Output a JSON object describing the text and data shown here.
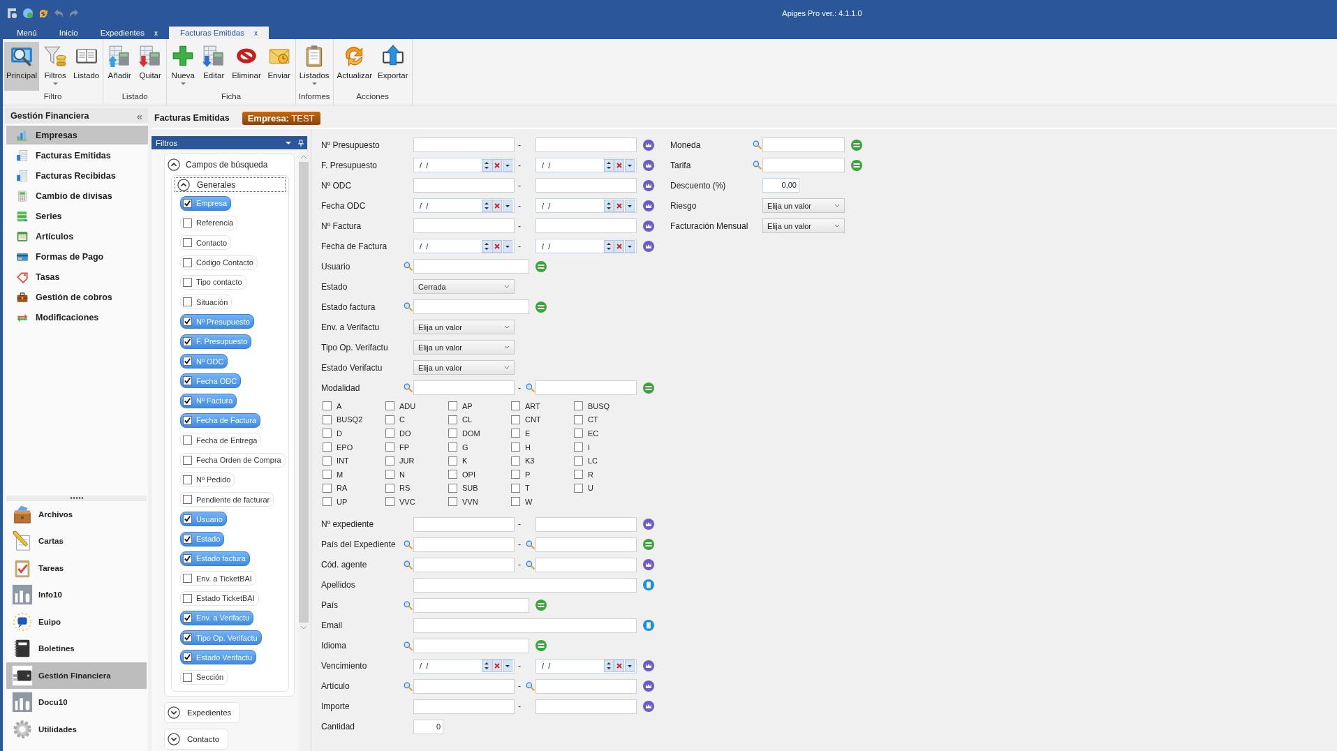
{
  "window": {
    "title": "Apiges Pro ver.: 4.1.1.0"
  },
  "tabs": [
    {
      "label": "Menú",
      "selected": false
    },
    {
      "label": "Inicio",
      "selected": false
    },
    {
      "label": "Expedientes",
      "selected": false,
      "close": "x"
    },
    {
      "label": "Facturas Emitidas",
      "selected": true,
      "close": "x"
    }
  ],
  "ribbon": {
    "groups": [
      {
        "label": "Filtro",
        "buttons": [
          {
            "label": "Principal",
            "kind": "magnifier",
            "selected": true,
            "dropdown": false
          },
          {
            "label": "Filtros",
            "kind": "funnel",
            "selected": false,
            "dropdown": true
          },
          {
            "label": "Listado",
            "kind": "book",
            "selected": false,
            "dropdown": false
          }
        ]
      },
      {
        "label": "Listado",
        "buttons": [
          {
            "label": "Añadir",
            "kind": "sheet_add",
            "selected": false,
            "dropdown": false
          },
          {
            "label": "Quitar",
            "kind": "sheet_remove",
            "selected": false,
            "dropdown": false
          }
        ]
      },
      {
        "label": "Ficha",
        "buttons": [
          {
            "label": "Nueva",
            "kind": "plus",
            "selected": false,
            "dropdown": true
          },
          {
            "label": "Editar",
            "kind": "sheet_edit",
            "selected": false,
            "dropdown": false
          },
          {
            "label": "Eliminar",
            "kind": "forbidden",
            "selected": false,
            "dropdown": false
          },
          {
            "label": "Enviar",
            "kind": "mail",
            "selected": false,
            "dropdown": false
          }
        ]
      },
      {
        "label": "Informes",
        "buttons": [
          {
            "label": "Listados",
            "kind": "clipboard",
            "selected": false,
            "dropdown": true
          }
        ]
      },
      {
        "label": "Acciones",
        "buttons": [
          {
            "label": "Actualizar",
            "kind": "refresh",
            "selected": false,
            "dropdown": false
          },
          {
            "label": "Exportar",
            "kind": "export",
            "selected": false,
            "dropdown": false
          }
        ]
      }
    ]
  },
  "sidebar": {
    "title": "Gestión Financiera",
    "collapse": "«",
    "items": [
      {
        "label": "Empresas",
        "kind": "barchart",
        "selected": true
      },
      {
        "label": "Facturas Emitidas",
        "kind": "document",
        "selected": false
      },
      {
        "label": "Facturas Recibidas",
        "kind": "document",
        "selected": false
      },
      {
        "label": "Cambio de divisas",
        "kind": "calc",
        "selected": false
      },
      {
        "label": "Series",
        "kind": "stack",
        "selected": false
      },
      {
        "label": "Artículos",
        "kind": "window",
        "selected": false
      },
      {
        "label": "Formas de Pago",
        "kind": "card",
        "selected": false
      },
      {
        "label": "Tasas",
        "kind": "tag",
        "selected": false
      },
      {
        "label": "Gestión de cobros",
        "kind": "briefcase",
        "selected": false
      },
      {
        "label": "Modificaciones",
        "kind": "arrows",
        "selected": false
      }
    ],
    "modules": [
      {
        "label": "Archivos",
        "kind": "chest",
        "selected": false
      },
      {
        "label": "Cartas",
        "kind": "pencil",
        "selected": false
      },
      {
        "label": "Tareas",
        "kind": "tasks",
        "selected": false
      },
      {
        "label": "Info10",
        "kind": "tile",
        "selected": false
      },
      {
        "label": "Euipo",
        "kind": "chat",
        "selected": false
      },
      {
        "label": "Boletines",
        "kind": "notebook",
        "selected": false
      },
      {
        "label": "Gestión Financiera",
        "kind": "wallet",
        "selected": true
      },
      {
        "label": "Docu10",
        "kind": "tile",
        "selected": false
      },
      {
        "label": "Utilidades",
        "kind": "gear",
        "selected": false
      }
    ]
  },
  "content": {
    "title": "Facturas Emitidas",
    "badge": {
      "label": "Empresa:",
      "value": "TEST"
    }
  },
  "filters": {
    "title": "Filtros",
    "group": {
      "label": "Campos de búsqueda",
      "expanded": true
    },
    "subgroup": {
      "label": "Generales",
      "expanded": true
    },
    "fields": [
      {
        "label": "Empresa",
        "checked": true
      },
      {
        "label": "Referencia",
        "checked": false
      },
      {
        "label": "Contacto",
        "checked": false
      },
      {
        "label": "Código Contacto",
        "checked": false
      },
      {
        "label": "Tipo contacto",
        "checked": false
      },
      {
        "label": "Situación",
        "checked": false
      },
      {
        "label": "Nº Presupuesto",
        "checked": true
      },
      {
        "label": "F. Presupuesto",
        "checked": true
      },
      {
        "label": "Nº ODC",
        "checked": true
      },
      {
        "label": "Fecha ODC",
        "checked": true
      },
      {
        "label": "Nº Factura",
        "checked": true
      },
      {
        "label": "Fecha de Factura",
        "checked": true
      },
      {
        "label": "Fecha de Entrega",
        "checked": false
      },
      {
        "label": "Fecha Orden de Compra",
        "checked": false
      },
      {
        "label": "Nº Pedido",
        "checked": false
      },
      {
        "label": "Pendiente de facturar",
        "checked": false
      },
      {
        "label": "Usuario",
        "checked": true
      },
      {
        "label": "Estado",
        "checked": true
      },
      {
        "label": "Estado factura",
        "checked": true
      },
      {
        "label": "Env. a TicketBAI",
        "checked": false
      },
      {
        "label": "Estado TicketBAI",
        "checked": false
      },
      {
        "label": "Env. a Verifactu",
        "checked": true
      },
      {
        "label": "Tipo Op. Verifactu",
        "checked": true
      },
      {
        "label": "Estado Verifactu",
        "checked": true
      },
      {
        "label": "Sección",
        "checked": false
      }
    ],
    "other_groups": [
      {
        "label": "Expedientes",
        "expanded": false
      },
      {
        "label": "Contacto",
        "expanded": false
      }
    ]
  },
  "form": {
    "rows": [
      {
        "kind": "range",
        "label": "Nº Presupuesto",
        "separator": "-",
        "action": {
          "kind": "crown"
        }
      },
      {
        "kind": "date_range",
        "label": "F. Presupuesto",
        "from": "/  /",
        "separator": "-",
        "to": "/  /",
        "action": {
          "kind": "crown"
        }
      },
      {
        "kind": "range",
        "label": "Nº ODC",
        "separator": "-",
        "action": {
          "kind": "crown"
        }
      },
      {
        "kind": "date_range",
        "label": "Fecha ODC",
        "from": "/  /",
        "separator": "-",
        "to": "/  /",
        "action": {
          "kind": "crown"
        }
      },
      {
        "kind": "range",
        "label": "Nº Factura",
        "separator": "-",
        "action": {
          "kind": "crown"
        }
      },
      {
        "kind": "date_range",
        "label": "Fecha de Factura",
        "from": "/  /",
        "separator": "-",
        "to": "/  /",
        "action": {
          "kind": "crown"
        }
      },
      {
        "kind": "lookup",
        "label": "Usuario",
        "action": {
          "kind": "equals"
        }
      },
      {
        "kind": "select",
        "label": "Estado",
        "value": "Cerrada"
      },
      {
        "kind": "lookup",
        "label": "Estado factura",
        "action": {
          "kind": "equals"
        }
      },
      {
        "kind": "select",
        "label": "Env. a Verifactu",
        "value": "Elija un valor"
      },
      {
        "kind": "select",
        "label": "Tipo Op. Verifactu",
        "value": "Elija un valor"
      },
      {
        "kind": "select",
        "label": "Estado Verifactu",
        "value": "Elija un valor"
      },
      {
        "kind": "lookup_range",
        "label": "Modalidad",
        "separator": "-",
        "action": {
          "kind": "equals"
        }
      },
      {
        "kind": "checkboxes",
        "options": [
          {
            "label": "A",
            "checked": false
          },
          {
            "label": "ADU",
            "checked": false
          },
          {
            "label": "AP",
            "checked": false
          },
          {
            "label": "ART",
            "checked": false
          },
          {
            "label": "BUSQ",
            "checked": false
          },
          {
            "label": "BUSQ2",
            "checked": false
          },
          {
            "label": "C",
            "checked": false
          },
          {
            "label": "CL",
            "checked": false
          },
          {
            "label": "CNT",
            "checked": false
          },
          {
            "label": "CT",
            "checked": false
          },
          {
            "label": "D",
            "checked": false
          },
          {
            "label": "DO",
            "checked": false
          },
          {
            "label": "DOM",
            "checked": false
          },
          {
            "label": "E",
            "checked": false
          },
          {
            "label": "EC",
            "checked": false
          },
          {
            "label": "EPO",
            "checked": false
          },
          {
            "label": "FP",
            "checked": false
          },
          {
            "label": "G",
            "checked": false
          },
          {
            "label": "H",
            "checked": false
          },
          {
            "label": "I",
            "checked": false
          },
          {
            "label": "INT",
            "checked": false
          },
          {
            "label": "JUR",
            "checked": false
          },
          {
            "label": "K",
            "checked": false
          },
          {
            "label": "K3",
            "checked": false
          },
          {
            "label": "LC",
            "checked": false
          },
          {
            "label": "M",
            "checked": false
          },
          {
            "label": "N",
            "checked": false
          },
          {
            "label": "OPI",
            "checked": false
          },
          {
            "label": "P",
            "checked": false
          },
          {
            "label": "R",
            "checked": false
          },
          {
            "label": "RA",
            "checked": false
          },
          {
            "label": "RS",
            "checked": false
          },
          {
            "label": "SUB",
            "checked": false
          },
          {
            "label": "T",
            "checked": false
          },
          {
            "label": "U",
            "checked": false
          },
          {
            "label": "UP",
            "checked": false
          },
          {
            "label": "VVC",
            "checked": false
          },
          {
            "label": "VVN",
            "checked": false
          },
          {
            "label": "W",
            "checked": false
          }
        ]
      },
      {
        "kind": "range",
        "label": "Nº expediente",
        "separator": "-",
        "action": {
          "kind": "crown"
        }
      },
      {
        "kind": "lookup_range",
        "label": "País del Expediente",
        "separator": "-",
        "action": {
          "kind": "equals"
        }
      },
      {
        "kind": "lookup_range",
        "label": "Cód. agente",
        "separator": "-",
        "action": {
          "kind": "crown"
        }
      },
      {
        "kind": "wide",
        "label": "Apellidos",
        "action": {
          "kind": "calc"
        }
      },
      {
        "kind": "lookup",
        "label": "País",
        "action": {
          "kind": "equals"
        }
      },
      {
        "kind": "wide",
        "label": "Email",
        "action": {
          "kind": "calc"
        }
      },
      {
        "kind": "lookup",
        "label": "Idioma",
        "action": {
          "kind": "equals"
        }
      },
      {
        "kind": "date_range",
        "label": "Vencimiento",
        "from": "/  /",
        "separator": "-",
        "to": "/  /",
        "action": {
          "kind": "crown"
        }
      },
      {
        "kind": "lookup_range",
        "label": "Artículo",
        "separator": "-",
        "action": {
          "kind": "crown"
        }
      },
      {
        "kind": "range",
        "label": "Importe",
        "separator": "-",
        "action": {
          "kind": "crown"
        }
      },
      {
        "kind": "number",
        "label": "Cantidad",
        "value": "0"
      }
    ],
    "side_rows": [
      {
        "kind": "lookup",
        "label": "Moneda",
        "action": {
          "kind": "equals"
        }
      },
      {
        "kind": "lookup",
        "label": "Tarifa",
        "action": {
          "kind": "equals"
        }
      },
      {
        "kind": "number",
        "label": "Descuento (%)",
        "value": "0,00"
      },
      {
        "kind": "select",
        "label": "Riesgo",
        "value": "Elija un valor"
      },
      {
        "kind": "select",
        "label": "Facturación Mensual",
        "value": "Elija un valor"
      }
    ]
  }
}
